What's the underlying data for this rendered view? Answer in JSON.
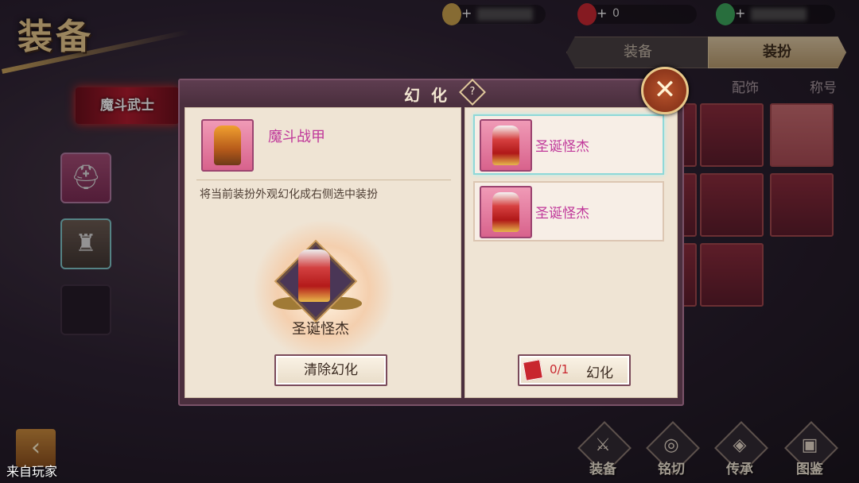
{
  "header": {
    "title": "装备",
    "character_badge": "魔斗武士"
  },
  "currency": [
    {
      "icon": "coin-icon",
      "value": ""
    },
    {
      "icon": "red-drop-icon",
      "value": "0"
    },
    {
      "icon": "green-drop-icon",
      "value": ""
    }
  ],
  "right_panel": {
    "tabs": [
      {
        "label": "装备"
      },
      {
        "label": "装扮",
        "selected": true
      }
    ],
    "subtabs": [
      {
        "label": "配饰"
      },
      {
        "label": "称号"
      }
    ]
  },
  "dialog": {
    "title": "幻化",
    "help": "?",
    "current": {
      "name": "魔斗战甲"
    },
    "hint": "将当前装扮外观幻化成右侧选中装扮",
    "preview": {
      "name": "圣诞怪杰"
    },
    "clear_label": "清除幻化",
    "options": [
      {
        "name": "圣诞怪杰",
        "selected": true
      },
      {
        "name": "圣诞怪杰"
      }
    ],
    "transform": {
      "count": "0/1",
      "label": "幻化"
    },
    "close": "✕"
  },
  "bottom_nav": [
    {
      "label": "装备"
    },
    {
      "label": "铭切"
    },
    {
      "label": "传承"
    },
    {
      "label": "图鉴"
    }
  ],
  "back": "‹",
  "watermark": "来自玩家"
}
